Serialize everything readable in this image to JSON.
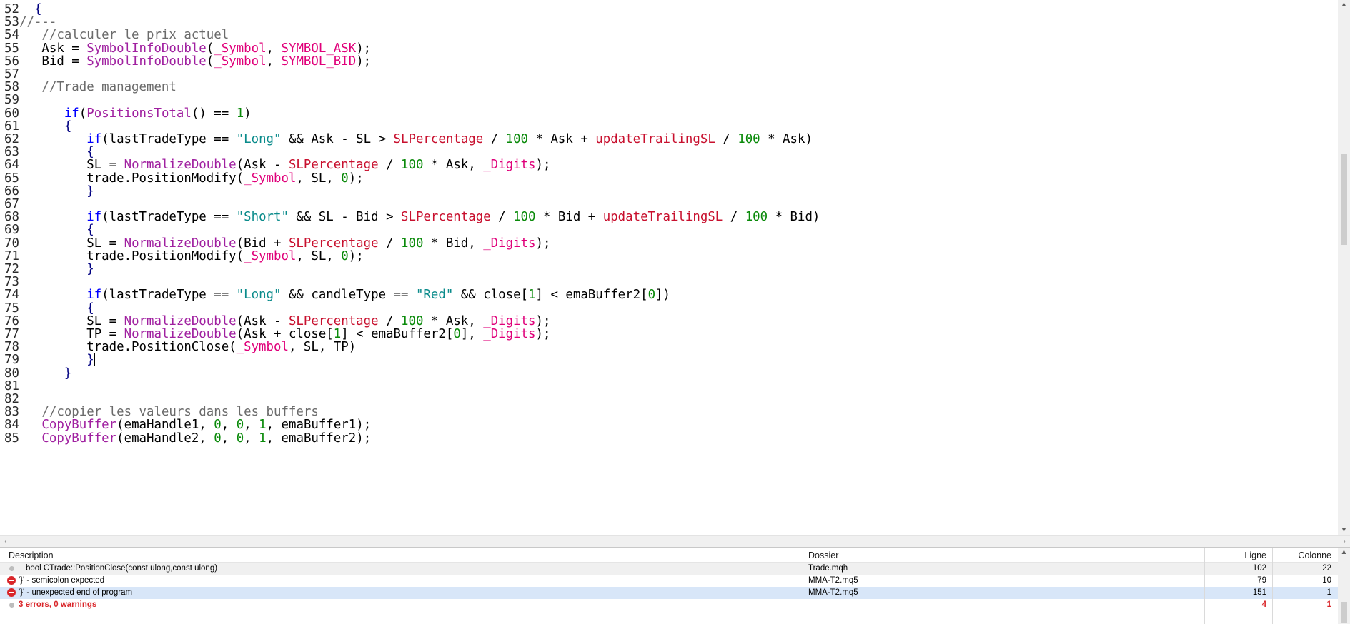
{
  "editor": {
    "lines": [
      {
        "n": "52",
        "t": [
          [
            "br",
            "  {"
          ]
        ]
      },
      {
        "n": "53",
        "t": [
          [
            "cm",
            "//---"
          ]
        ]
      },
      {
        "n": "54",
        "t": [
          [
            "cm",
            "   //calculer le prix actuel"
          ]
        ]
      },
      {
        "n": "55",
        "t": [
          [
            "p",
            "   Ask = "
          ],
          [
            "fn",
            "SymbolInfoDouble"
          ],
          [
            "p",
            "("
          ],
          [
            "sys",
            "_Symbol"
          ],
          [
            "p",
            ", "
          ],
          [
            "con",
            "SYMBOL_ASK"
          ],
          [
            "p",
            ");"
          ]
        ]
      },
      {
        "n": "56",
        "t": [
          [
            "p",
            "   Bid = "
          ],
          [
            "fn",
            "SymbolInfoDouble"
          ],
          [
            "p",
            "("
          ],
          [
            "sys",
            "_Symbol"
          ],
          [
            "p",
            ", "
          ],
          [
            "con",
            "SYMBOL_BID"
          ],
          [
            "p",
            ");"
          ]
        ]
      },
      {
        "n": "57",
        "t": []
      },
      {
        "n": "58",
        "t": [
          [
            "cm",
            "   //Trade management"
          ]
        ]
      },
      {
        "n": "59",
        "t": []
      },
      {
        "n": "60",
        "t": [
          [
            "p",
            "      "
          ],
          [
            "k",
            "if"
          ],
          [
            "p",
            "("
          ],
          [
            "fn",
            "PositionsTotal"
          ],
          [
            "p",
            "() == "
          ],
          [
            "num",
            "1"
          ],
          [
            "p",
            ")"
          ]
        ]
      },
      {
        "n": "61",
        "t": [
          [
            "br",
            "      {"
          ]
        ]
      },
      {
        "n": "62",
        "t": [
          [
            "p",
            "         "
          ],
          [
            "k",
            "if"
          ],
          [
            "p",
            "(lastTradeType == "
          ],
          [
            "str",
            "\"Long\""
          ],
          [
            "p",
            " && Ask - SL > "
          ],
          [
            "var",
            "SLPercentage"
          ],
          [
            "p",
            " / "
          ],
          [
            "num",
            "100"
          ],
          [
            "p",
            " * Ask + "
          ],
          [
            "var",
            "updateTrailingSL"
          ],
          [
            "p",
            " / "
          ],
          [
            "num",
            "100"
          ],
          [
            "p",
            " * Ask)"
          ]
        ]
      },
      {
        "n": "63",
        "t": [
          [
            "br",
            "         {"
          ]
        ]
      },
      {
        "n": "64",
        "t": [
          [
            "p",
            "         SL = "
          ],
          [
            "fn",
            "NormalizeDouble"
          ],
          [
            "p",
            "(Ask - "
          ],
          [
            "var",
            "SLPercentage"
          ],
          [
            "p",
            " / "
          ],
          [
            "num",
            "100"
          ],
          [
            "p",
            " * Ask, "
          ],
          [
            "sys",
            "_Digits"
          ],
          [
            "p",
            ");"
          ]
        ]
      },
      {
        "n": "65",
        "t": [
          [
            "p",
            "         trade.PositionModify("
          ],
          [
            "sys",
            "_Symbol"
          ],
          [
            "p",
            ", SL, "
          ],
          [
            "num",
            "0"
          ],
          [
            "p",
            ");"
          ]
        ]
      },
      {
        "n": "66",
        "t": [
          [
            "br",
            "         }"
          ]
        ]
      },
      {
        "n": "67",
        "t": []
      },
      {
        "n": "68",
        "t": [
          [
            "p",
            "         "
          ],
          [
            "k",
            "if"
          ],
          [
            "p",
            "(lastTradeType == "
          ],
          [
            "str",
            "\"Short\""
          ],
          [
            "p",
            " && SL - Bid > "
          ],
          [
            "var",
            "SLPercentage"
          ],
          [
            "p",
            " / "
          ],
          [
            "num",
            "100"
          ],
          [
            "p",
            " * Bid + "
          ],
          [
            "var",
            "updateTrailingSL"
          ],
          [
            "p",
            " / "
          ],
          [
            "num",
            "100"
          ],
          [
            "p",
            " * Bid)"
          ]
        ]
      },
      {
        "n": "69",
        "t": [
          [
            "br",
            "         {"
          ]
        ]
      },
      {
        "n": "70",
        "t": [
          [
            "p",
            "         SL = "
          ],
          [
            "fn",
            "NormalizeDouble"
          ],
          [
            "p",
            "(Bid + "
          ],
          [
            "var",
            "SLPercentage"
          ],
          [
            "p",
            " / "
          ],
          [
            "num",
            "100"
          ],
          [
            "p",
            " * Bid, "
          ],
          [
            "sys",
            "_Digits"
          ],
          [
            "p",
            ");"
          ]
        ]
      },
      {
        "n": "71",
        "t": [
          [
            "p",
            "         trade.PositionModify("
          ],
          [
            "sys",
            "_Symbol"
          ],
          [
            "p",
            ", SL, "
          ],
          [
            "num",
            "0"
          ],
          [
            "p",
            ");"
          ]
        ]
      },
      {
        "n": "72",
        "t": [
          [
            "br",
            "         }"
          ]
        ]
      },
      {
        "n": "73",
        "t": []
      },
      {
        "n": "74",
        "t": [
          [
            "p",
            "         "
          ],
          [
            "k",
            "if"
          ],
          [
            "p",
            "(lastTradeType == "
          ],
          [
            "str",
            "\"Long\""
          ],
          [
            "p",
            " && candleType == "
          ],
          [
            "str",
            "\"Red\""
          ],
          [
            "p",
            " && close["
          ],
          [
            "num",
            "1"
          ],
          [
            "p",
            "] < emaBuffer2["
          ],
          [
            "num",
            "0"
          ],
          [
            "p",
            "])"
          ]
        ]
      },
      {
        "n": "75",
        "t": [
          [
            "br",
            "         {"
          ]
        ]
      },
      {
        "n": "76",
        "t": [
          [
            "p",
            "         SL = "
          ],
          [
            "fn",
            "NormalizeDouble"
          ],
          [
            "p",
            "(Ask - "
          ],
          [
            "var",
            "SLPercentage"
          ],
          [
            "p",
            " / "
          ],
          [
            "num",
            "100"
          ],
          [
            "p",
            " * Ask, "
          ],
          [
            "sys",
            "_Digits"
          ],
          [
            "p",
            ");"
          ]
        ]
      },
      {
        "n": "77",
        "t": [
          [
            "p",
            "         TP = "
          ],
          [
            "fn",
            "NormalizeDouble"
          ],
          [
            "p",
            "(Ask + close["
          ],
          [
            "num",
            "1"
          ],
          [
            "p",
            "] < emaBuffer2["
          ],
          [
            "num",
            "0"
          ],
          [
            "p",
            "], "
          ],
          [
            "sys",
            "_Digits"
          ],
          [
            "p",
            ");"
          ]
        ]
      },
      {
        "n": "78",
        "t": [
          [
            "p",
            "         trade.PositionClose("
          ],
          [
            "sys",
            "_Symbol"
          ],
          [
            "p",
            ", SL, TP)"
          ]
        ]
      },
      {
        "n": "79",
        "t": [
          [
            "br",
            "         }"
          ],
          [
            "caret",
            ""
          ]
        ]
      },
      {
        "n": "80",
        "t": [
          [
            "br",
            "      }"
          ]
        ]
      },
      {
        "n": "81",
        "t": []
      },
      {
        "n": "82",
        "t": []
      },
      {
        "n": "83",
        "t": [
          [
            "cm",
            "   //copier les valeurs dans les buffers"
          ]
        ]
      },
      {
        "n": "84",
        "t": [
          [
            "p",
            "   "
          ],
          [
            "fn",
            "CopyBuffer"
          ],
          [
            "p",
            "(emaHandle1, "
          ],
          [
            "num",
            "0"
          ],
          [
            "p",
            ", "
          ],
          [
            "num",
            "0"
          ],
          [
            "p",
            ", "
          ],
          [
            "num",
            "1"
          ],
          [
            "p",
            ", emaBuffer1);"
          ]
        ]
      },
      {
        "n": "85",
        "t": [
          [
            "p",
            "   "
          ],
          [
            "fn",
            "CopyBuffer"
          ],
          [
            "p",
            "(emaHandle2, "
          ],
          [
            "num",
            "0"
          ],
          [
            "p",
            ", "
          ],
          [
            "num",
            "0"
          ],
          [
            "p",
            ", "
          ],
          [
            "num",
            "1"
          ],
          [
            "p",
            ", emaBuffer2);"
          ]
        ]
      }
    ]
  },
  "errors": {
    "columns": {
      "description": "Description",
      "dossier": "Dossier",
      "ligne": "Ligne",
      "colonne": "Colonne"
    },
    "rows": [
      {
        "type": "info",
        "description": "bool CTrade::PositionClose(const ulong,const ulong)",
        "dossier": "Trade.mqh",
        "ligne": "102",
        "colonne": "22"
      },
      {
        "type": "error",
        "description": "'}' - semicolon expected",
        "dossier": "MMA-T2.mq5",
        "ligne": "79",
        "colonne": "10"
      },
      {
        "type": "error",
        "description": "'}' - unexpected end of program",
        "dossier": "MMA-T2.mq5",
        "ligne": "151",
        "colonne": "1"
      },
      {
        "type": "summary",
        "description": "3 errors, 0 warnings",
        "dossier": "",
        "ligne": "4",
        "colonne": "1"
      }
    ]
  },
  "colors": {
    "keyword": "#0000ff",
    "function": "#a020a0",
    "system": "#e0007a",
    "variable": "#c8102e",
    "number": "#0a8a0a",
    "string": "#0a8b8b",
    "comment": "#6b6b6b",
    "error": "#d9262a",
    "selected_row": "#d8e6f8",
    "info_row": "#f0f0f0"
  }
}
